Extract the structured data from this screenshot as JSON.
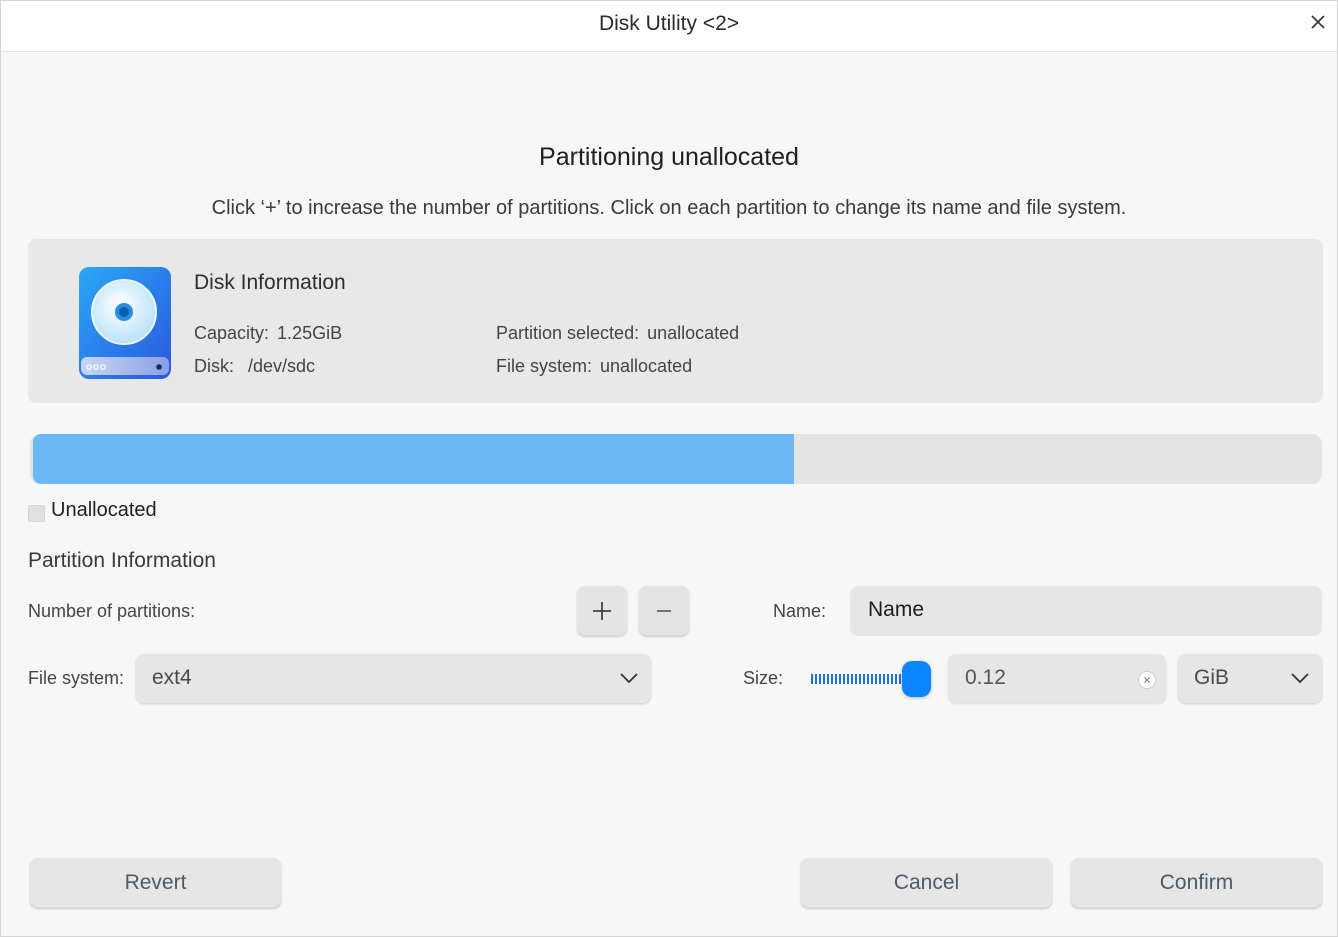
{
  "window": {
    "title": "Disk Utility <2>"
  },
  "page": {
    "heading": "Partitioning unallocated",
    "subheading": "Click ‘+’ to increase the number of partitions. Click on each partition to change its name and file system."
  },
  "disk_info": {
    "title": "Disk Information",
    "capacity_label": "Capacity:",
    "capacity_value": "1.25GiB",
    "disk_label": "Disk:",
    "disk_value": "/dev/sdc",
    "partition_selected_label": "Partition selected:",
    "partition_selected_value": "unallocated",
    "file_system_label": "File system:",
    "file_system_value": "unallocated",
    "icon": "hard-disk-icon"
  },
  "partition_bar": {
    "used_fraction": 0.59,
    "fill_color": "#6cb8f7",
    "track_color": "#e4e4e4"
  },
  "legend": {
    "label": "Unallocated"
  },
  "partition_info": {
    "title": "Partition Information",
    "num_partitions_label": "Number of partitions:",
    "add_icon": "plus-icon",
    "remove_icon": "minus-icon",
    "name_label": "Name:",
    "name_value": "Name",
    "file_system_label": "File system:",
    "file_system_value": "ext4",
    "size_label": "Size:",
    "size_value": "0.12",
    "size_unit": "GiB",
    "size_slider_level": 1.0,
    "accent_color": "#0a84ff"
  },
  "buttons": {
    "revert": "Revert",
    "cancel": "Cancel",
    "confirm": "Confirm"
  }
}
